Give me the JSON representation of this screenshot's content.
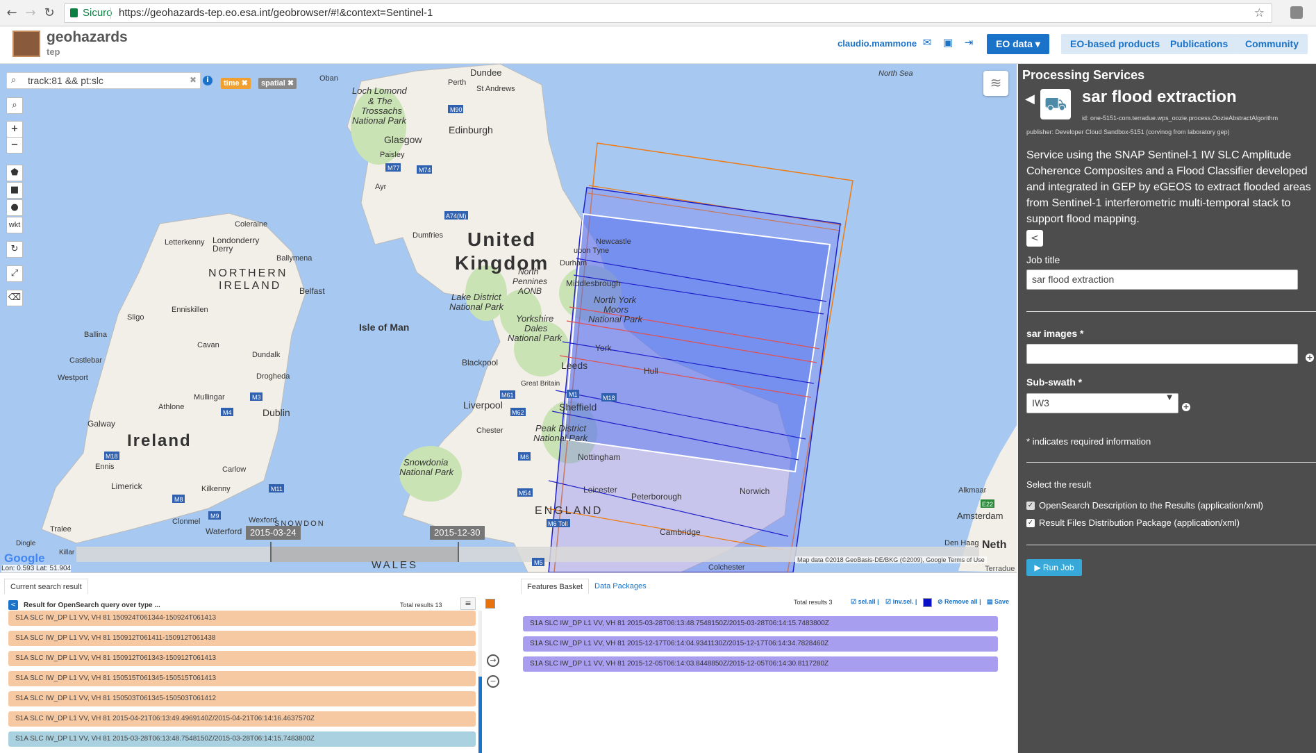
{
  "browser": {
    "secure_label": "Sicuro",
    "url": "https://geohazards-tep.eo.esa.int/geobrowser/#!&context=Sentinel-1"
  },
  "header": {
    "logo_title": "geohazards",
    "logo_sub": "tep",
    "username": "claudio.mammone",
    "nav": {
      "eo_data": "EO data ▾",
      "eo_products": "EO-based products",
      "publications": "Publications",
      "community": "Community"
    }
  },
  "map": {
    "search_value": "track:81 && pt:slc",
    "tags": {
      "time": "time ✖",
      "spatial": "spatial ✖"
    },
    "tools": {
      "wkt": "wkt"
    },
    "timeline": {
      "start": "2015-03-24",
      "end": "2015-12-30"
    },
    "google": "Google",
    "attribution": "Map data ©2018 GeoBasis-DE/BKG (©2009), Google    Terms of Use",
    "lonlat": "Lon: 0.593 Lat: 51.904",
    "terradue": "Terradue",
    "labels": {
      "north_sea": "North Sea",
      "united": "United",
      "kingdom": "Kingdom",
      "ireland": "Ireland",
      "northern": "NORTHERN",
      "ireland_upper": "IRELAND",
      "isle_of_man": "Isle of Man",
      "england": "ENGLAND",
      "wales": "WALES",
      "edinburgh": "Edinburgh",
      "glasgow": "Glasgow",
      "dundee": "Dundee",
      "perth": "Perth",
      "st_andrews": "St Andrews",
      "oban": "Oban",
      "loch_lomond": "Loch Lomond",
      "and_the": "& The",
      "trossachs": "Trossachs",
      "national_park": "National Park",
      "paisley": "Paisley",
      "ayr": "Ayr",
      "dumfries": "Dumfries",
      "coleraine": "Coleraine",
      "londonderry": "Londonderry",
      "derry": "Derry",
      "letterkenny": "Letterkenny",
      "ballymena": "Ballymena",
      "belfast": "Belfast",
      "enniskillen": "Enniskillen",
      "sligo": "Sligo",
      "ballina": "Ballina",
      "castlebar": "Castlebar",
      "westport": "Westport",
      "cavan": "Cavan",
      "dundalk": "Dundalk",
      "drogheda": "Drogheda",
      "mullingar": "Mullingar",
      "athlone": "Athlone",
      "dublin": "Dublin",
      "galway": "Galway",
      "ennis": "Ennis",
      "limerick": "Limerick",
      "kilkenny": "Kilkenny",
      "carlow": "Carlow",
      "clonmel": "Clonmel",
      "waterford": "Waterford",
      "wexford": "Wexford",
      "snowdon": "SNOWDON",
      "tralee": "Tralee",
      "dingle": "Dingle",
      "killarney": "Killar",
      "newcastle": "Newcastle",
      "upon_tyne": "upon Tyne",
      "durham": "Durham",
      "middlesbrough": "Middlesbrough",
      "north_pennines": "North",
      "pennines": "Pennines",
      "aonb": "AONB",
      "north_york": "North York",
      "moors": "Moors",
      "lake_district": "Lake District",
      "yorkshire": "Yorkshire",
      "dales": "Dales",
      "york": "York",
      "leeds": "Leeds",
      "hull": "Hull",
      "blackpool": "Blackpool",
      "great_britain": "Great Britain",
      "liverpool": "Liverpool",
      "sheffield": "Sheffield",
      "chester": "Chester",
      "peak_district": "Peak District",
      "snowdonia": "Snowdonia",
      "nottingham": "Nottingham",
      "leicester": "Leicester",
      "peterborough": "Peterborough",
      "norwich": "Norwich",
      "cambridge": "Cambridge",
      "alkmaar": "Alkmaar",
      "amsterdam": "Amsterdam",
      "neth": "Neth",
      "den_haag": "Den Haag",
      "colchester": "Colchester"
    },
    "roads": [
      "M90",
      "M77",
      "M74",
      "A74(M)",
      "M3",
      "M4",
      "M18",
      "M11",
      "M8",
      "M9",
      "M1",
      "M18",
      "M61",
      "M62",
      "M6",
      "M54",
      "M6 Toll",
      "M5",
      "E22"
    ]
  },
  "bottom_left": {
    "tab": "Current search result",
    "title": "Result for OpenSearch query over type ...",
    "total": "Total results   13",
    "rows": [
      {
        "text": "S1A SLC IW_DP L1 VV, VH 81 150924T061344-150924T061413",
        "style": "orange"
      },
      {
        "text": "S1A SLC IW_DP L1 VV, VH 81 150912T061411-150912T061438",
        "style": "orange"
      },
      {
        "text": "S1A SLC IW_DP L1 VV, VH 81 150912T061343-150912T061413",
        "style": "orange"
      },
      {
        "text": "S1A SLC IW_DP L1 VV, VH 81 150515T061345-150515T061413",
        "style": "orange"
      },
      {
        "text": "S1A SLC IW_DP L1 VV, VH 81 150503T061345-150503T061412",
        "style": "orange"
      },
      {
        "text": "S1A SLC IW_DP L1 VV, VH 81 2015-04-21T06:13:49.4969140Z/2015-04-21T06:14:16.4637570Z",
        "style": "orange"
      },
      {
        "text": "S1A SLC IW_DP L1 VV, VH 81 2015-03-28T06:13:48.7548150Z/2015-03-28T06:14:15.7483800Z",
        "style": "sel"
      }
    ]
  },
  "bottom_right": {
    "tab_basket": "Features Basket",
    "tab_packages": "Data Packages",
    "total": "Total results   3",
    "sel_all": "sel.all |",
    "inv_sel": "inv.sel. |",
    "remove_all": "Remove all |",
    "save": "Save",
    "rows": [
      "S1A SLC IW_DP L1 VV, VH 81 2015-03-28T06:13:48.7548150Z/2015-03-28T06:14:15.7483800Z",
      "S1A SLC IW_DP L1 VV, VH 81 2015-12-17T06:14:04.9341130Z/2015-12-17T06:14:34.7828460Z",
      "S1A SLC IW_DP L1 VV, VH 81 2015-12-05T06:14:03.8448850Z/2015-12-05T06:14:30.8117280Z"
    ]
  },
  "panel": {
    "heading": "Processing Services",
    "title": "sar flood extraction",
    "id": "id: one-5151-com.terradue.wps_oozie.process.OozieAbstractAlgorithm",
    "publisher": "publisher: Developer Cloud Sandbox-5151 (corvinog from laboratory gep)",
    "description": "Service using the SNAP Sentinel-1 IW SLC Amplitude Coherence Composites and a Flood Classifier developed and integrated in GEP by eGEOS to extract flooded areas from Sentinel-1 interferometric multi-temporal stack to support flood mapping.",
    "job_title_label": "Job title",
    "job_title_value": "sar flood extraction",
    "sar_images_label": "sar images *",
    "sar_images_value": "",
    "subswath_label": "Sub-swath *",
    "subswath_value": "IW3",
    "required_note": "* indicates required information",
    "select_result": "Select the result",
    "opt1": "OpenSearch Description to the Results (application/xml)",
    "opt2": "Result Files Distribution Package (application/xml)",
    "run": "Run Job"
  },
  "colors": {
    "accent": "#1a73c8",
    "panel_bg": "#4d4d4d",
    "orange_row": "#f7c9a3",
    "selected_row": "#a9d1e0",
    "basket_row": "#a89ef0"
  }
}
